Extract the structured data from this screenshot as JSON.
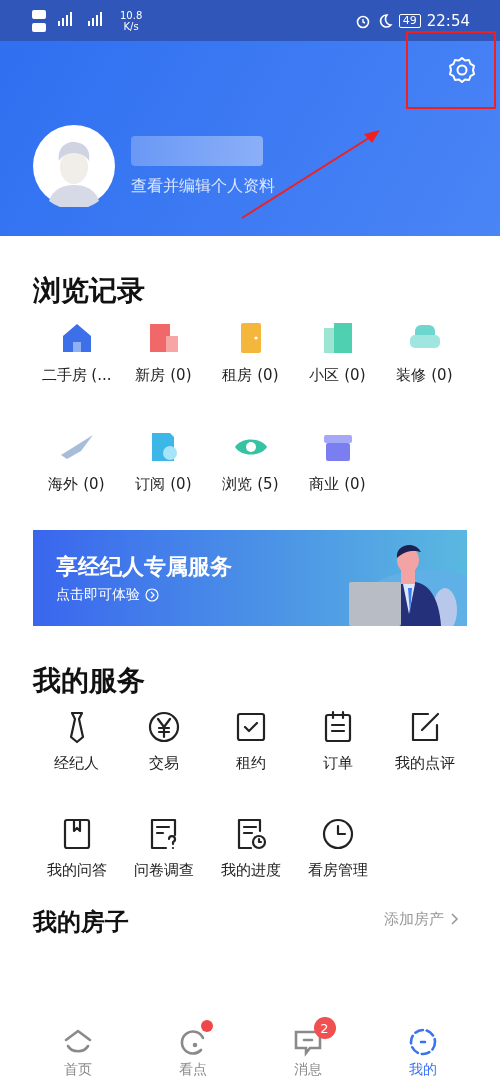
{
  "status_bar": {
    "speed": "10.8",
    "speed_unit": "K/s",
    "battery": "49",
    "time": "22:54"
  },
  "profile": {
    "subtitle": "查看并编辑个人资料"
  },
  "browse": {
    "title": "浏览记录",
    "items": [
      {
        "kind": "house",
        "label": "二手房 (..."
      },
      {
        "kind": "building",
        "label": "新房 (0)"
      },
      {
        "kind": "door",
        "label": "租房 (0)"
      },
      {
        "kind": "towers",
        "label": "小区 (0)"
      },
      {
        "kind": "sofa",
        "label": "装修 (0)"
      },
      {
        "kind": "plane",
        "label": "海外 (0)"
      },
      {
        "kind": "subscribe",
        "label": "订阅 (0)"
      },
      {
        "kind": "eye",
        "label": "浏览 (5)"
      },
      {
        "kind": "shop",
        "label": "商业 (0)"
      }
    ]
  },
  "banner": {
    "title": "享经纪人专属服务",
    "subtitle": "点击即可体验"
  },
  "services": {
    "title": "我的服务",
    "items": [
      {
        "kind": "tie",
        "label": "经纪人"
      },
      {
        "kind": "yen",
        "label": "交易"
      },
      {
        "kind": "check",
        "label": "租约"
      },
      {
        "kind": "list",
        "label": "订单"
      },
      {
        "kind": "edit",
        "label": "我的点评"
      },
      {
        "kind": "book",
        "label": "我的问答"
      },
      {
        "kind": "question",
        "label": "问卷调查"
      },
      {
        "kind": "progress",
        "label": "我的进度"
      },
      {
        "kind": "clock",
        "label": "看房管理"
      }
    ]
  },
  "my_house": {
    "title": "我的房子",
    "action": "添加房产"
  },
  "nav": [
    {
      "kind": "home",
      "label": "首页",
      "selected": false
    },
    {
      "kind": "watch",
      "label": "看点",
      "selected": false,
      "dot": true
    },
    {
      "kind": "message",
      "label": "消息",
      "selected": false,
      "badge": "2"
    },
    {
      "kind": "me",
      "label": "我的",
      "selected": true
    }
  ]
}
